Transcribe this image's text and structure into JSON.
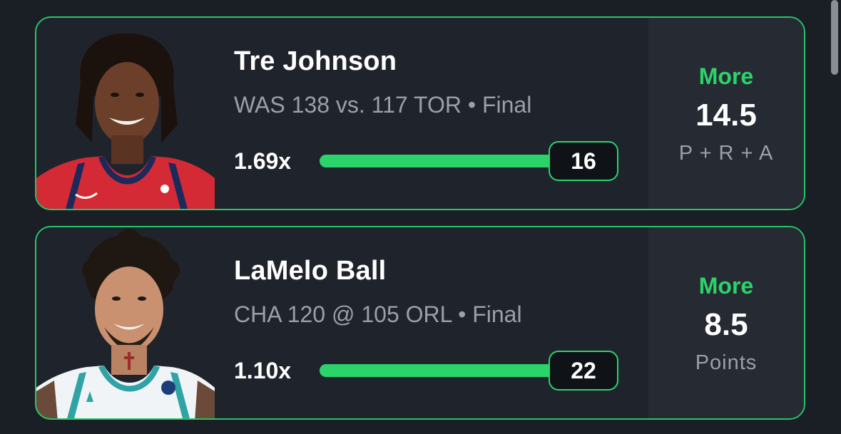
{
  "picks": [
    {
      "player_name": "Tre Johnson",
      "game_status": "WAS 138 vs. 117 TOR • Final",
      "multiplier": "1.69x",
      "actual_stat": "16",
      "progress_fraction": 1.0,
      "direction": "More",
      "line": "14.5",
      "stat_type": "P + R + A",
      "jersey_color": "#d42a35"
    },
    {
      "player_name": "LaMelo Ball",
      "game_status": "CHA 120 @ 105 ORL • Final",
      "multiplier": "1.10x",
      "actual_stat": "22",
      "progress_fraction": 1.0,
      "direction": "More",
      "line": "8.5",
      "stat_type": "Points",
      "jersey_color": "#f1f4f6"
    }
  ],
  "colors": {
    "accent_green": "#2ad46b",
    "card_border": "#27c566",
    "background": "#1a1e25"
  }
}
